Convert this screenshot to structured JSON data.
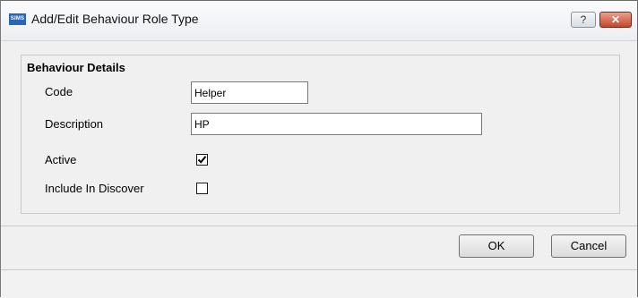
{
  "window": {
    "app_icon": "SIMS",
    "title": "Add/Edit Behaviour Role Type",
    "help_label": "?",
    "close_label": "✕"
  },
  "group": {
    "title": "Behaviour Details",
    "code_label": "Code",
    "code_value": "Helper",
    "description_label": "Description",
    "description_value": "HP",
    "active_label": "Active",
    "active_checked": true,
    "discover_label": "Include In Discover",
    "discover_checked": false
  },
  "buttons": {
    "ok": "OK",
    "cancel": "Cancel"
  },
  "icons": {
    "app": "sims-logo-icon",
    "help": "help-icon",
    "close": "close-icon",
    "check": "checkmark-icon"
  }
}
